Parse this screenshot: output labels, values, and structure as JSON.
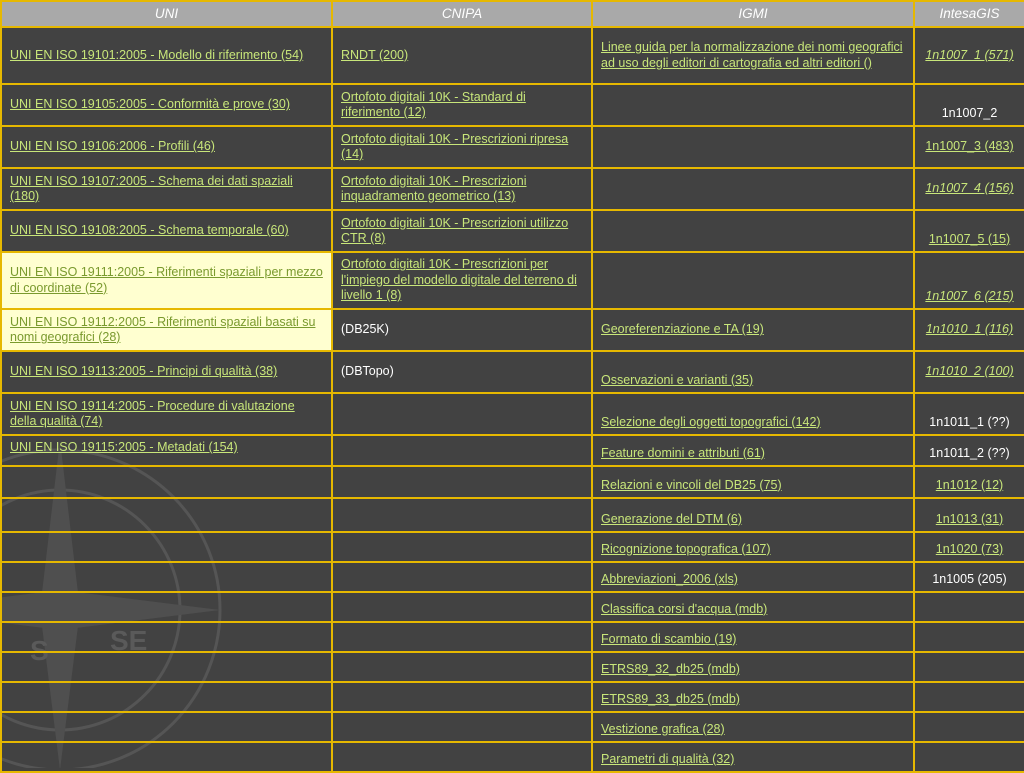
{
  "headers": [
    "UNI",
    "CNIPA",
    "IGMI",
    "IntesaGIS"
  ],
  "rows": [
    {
      "uni": "UNI EN ISO 19101:2005 - Modello di riferimento (54)",
      "cnipa": "RNDT (200)",
      "igmi": "Linee guida per la normalizzazione dei nomi geografici ad uso degli editori di cartografia ed altri editori ()",
      "intesa": "1n1007_1 (571)"
    },
    {
      "uni": "UNI EN ISO 19105:2005 - Conformità e prove (30)",
      "cnipa": "Ortofoto digitali 10K - Standard di riferimento (12)",
      "igmi": "",
      "intesa": "1n1007_2"
    },
    {
      "uni": "UNI EN ISO 19106:2006 - Profili (46)",
      "cnipa": "Ortofoto digitali 10K - Prescrizioni ripresa (14)",
      "igmi": "",
      "intesa": "1n1007_3 (483)"
    },
    {
      "uni": "UNI EN ISO 19107:2005 - Schema dei dati spaziali (180)",
      "cnipa": "Ortofoto digitali 10K - Prescrizioni inquadramento geometrico (13)",
      "igmi": "",
      "intesa": "1n1007_4 (156)"
    },
    {
      "uni": "UNI EN ISO 19108:2005 - Schema temporale (60)",
      "cnipa": "Ortofoto digitali 10K - Prescrizioni utilizzo CTR (8)",
      "igmi": "",
      "intesa": "1n1007_5 (15)"
    },
    {
      "uni": "UNI EN ISO 19111:2005 - Riferimenti spaziali per mezzo di coordinate (52)",
      "cnipa": "Ortofoto digitali 10K - Prescrizioni per l'impiego del modello digitale del terreno di livello 1 (8)",
      "igmi": "",
      "intesa": "1n1007_6 (215)"
    },
    {
      "uni": "UNI EN ISO 19112:2005 - Riferimenti spaziali basati su nomi geografici (28)",
      "cnipa": "(DB25K)",
      "igmi": "Georeferenziazione e TA (19)",
      "intesa": "1n1010_1 (116)"
    },
    {
      "uni": "UNI EN ISO 19113:2005 - Principi di qualità (38)",
      "cnipa": "(DBTopo)",
      "igmi": "Osservazioni e varianti (35)",
      "intesa": "1n1010_2 (100)"
    },
    {
      "uni": "UNI EN ISO 19114:2005 - Procedure di valutazione della qualità (74)",
      "cnipa": "",
      "igmi": "Selezione degli oggetti topografici (142)",
      "intesa": "1n1011_1 (??)"
    },
    {
      "uni": "UNI EN ISO 19115:2005 - Metadati (154)",
      "cnipa": "",
      "igmi": "Feature domini e attributi (61)",
      "intesa": "1n1011_2 (??)"
    },
    {
      "uni": "",
      "cnipa": "",
      "igmi": "Relazioni e vincoli del DB25 (75)",
      "intesa": "1n1012 (12)"
    },
    {
      "uni": "",
      "cnipa": "",
      "igmi": "Generazione del DTM (6)",
      "intesa": "1n1013 (31)"
    },
    {
      "uni": "",
      "cnipa": "",
      "igmi": "Ricognizione topografica (107)",
      "intesa": "1n1020 (73)"
    },
    {
      "uni": "",
      "cnipa": "",
      "igmi": "Abbreviazioni_2006 (xls)",
      "intesa": "1n1005 (205)"
    },
    {
      "uni": "",
      "cnipa": "",
      "igmi": "Classifica corsi d'acqua (mdb)",
      "intesa": ""
    },
    {
      "uni": "",
      "cnipa": "",
      "igmi": "Formato di scambio (19)",
      "intesa": ""
    },
    {
      "uni": "",
      "cnipa": "",
      "igmi": "ETRS89_32_db25 (mdb)",
      "intesa": ""
    },
    {
      "uni": "",
      "cnipa": "",
      "igmi": "ETRS89_33_db25 (mdb)",
      "intesa": ""
    },
    {
      "uni": "",
      "cnipa": "",
      "igmi": "Vestizione grafica (28)",
      "intesa": ""
    },
    {
      "uni": "",
      "cnipa": "",
      "igmi": "Parametri di qualità (32)",
      "intesa": ""
    }
  ],
  "colors": {
    "background": "#424242",
    "header_bg": "#a9a9a9",
    "grid_border": "#e6b800",
    "link": "#c8e67a",
    "highlight_bg": "#ffffd0"
  },
  "decoration_icon": "compass-rose-watermark-icon"
}
